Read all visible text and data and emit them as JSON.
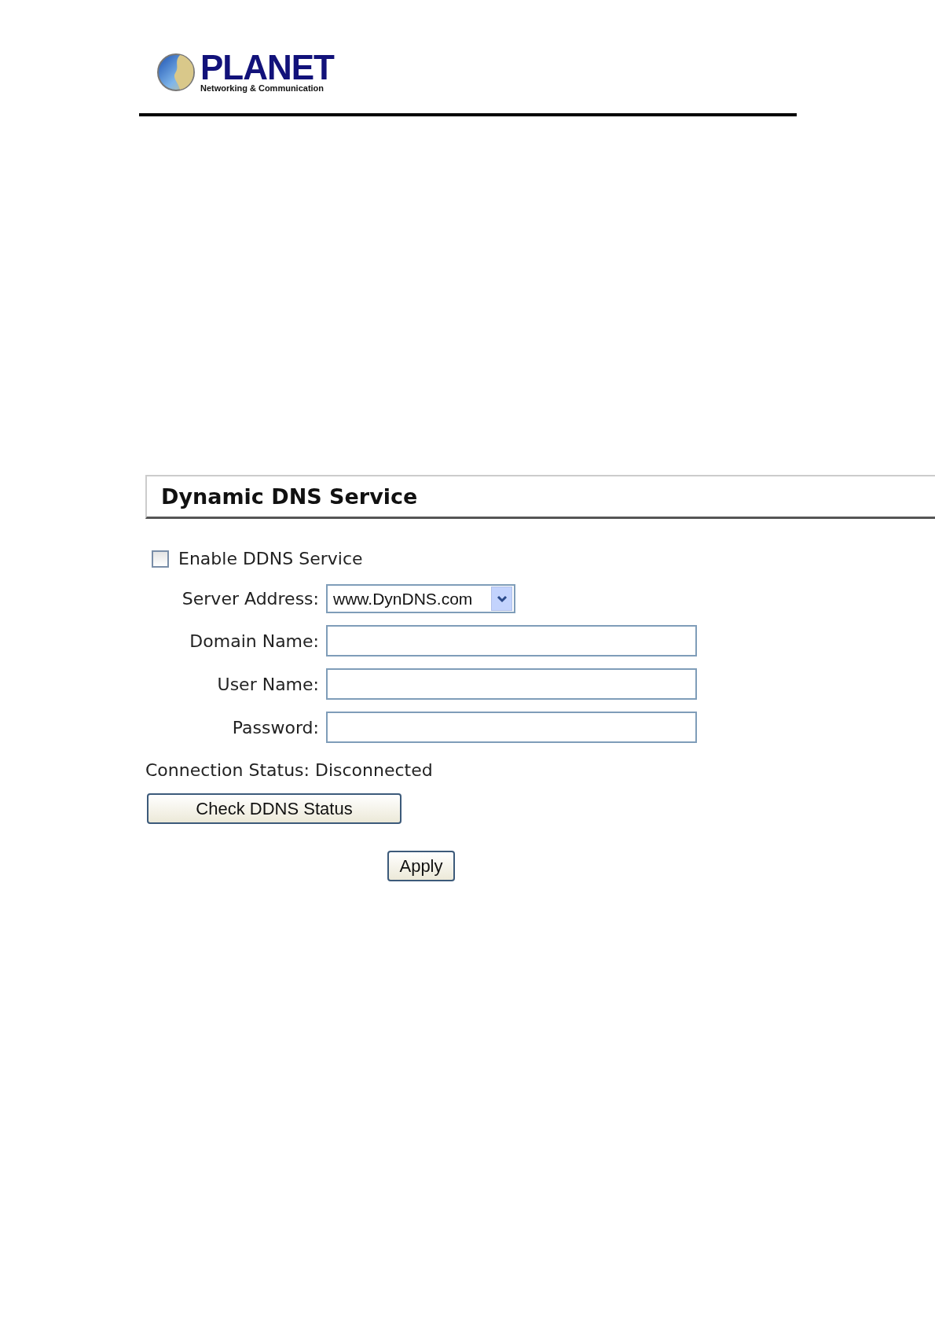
{
  "logo": {
    "name": "PLANET",
    "tagline": "Networking & Communication"
  },
  "panel": {
    "title": "Dynamic DNS Service"
  },
  "enable": {
    "label": "Enable DDNS Service",
    "checked": false
  },
  "fields": [
    {
      "kind": "select",
      "label": "Server Address:",
      "value": "www.DynDNS.com"
    },
    {
      "kind": "text",
      "label": "Domain Name:"
    },
    {
      "kind": "text",
      "label": "User Name:"
    },
    {
      "kind": "password",
      "label": "Password:"
    }
  ],
  "status": "Connection Status: Disconnected",
  "buttons": {
    "check": "Check DDNS Status",
    "apply": "Apply"
  }
}
